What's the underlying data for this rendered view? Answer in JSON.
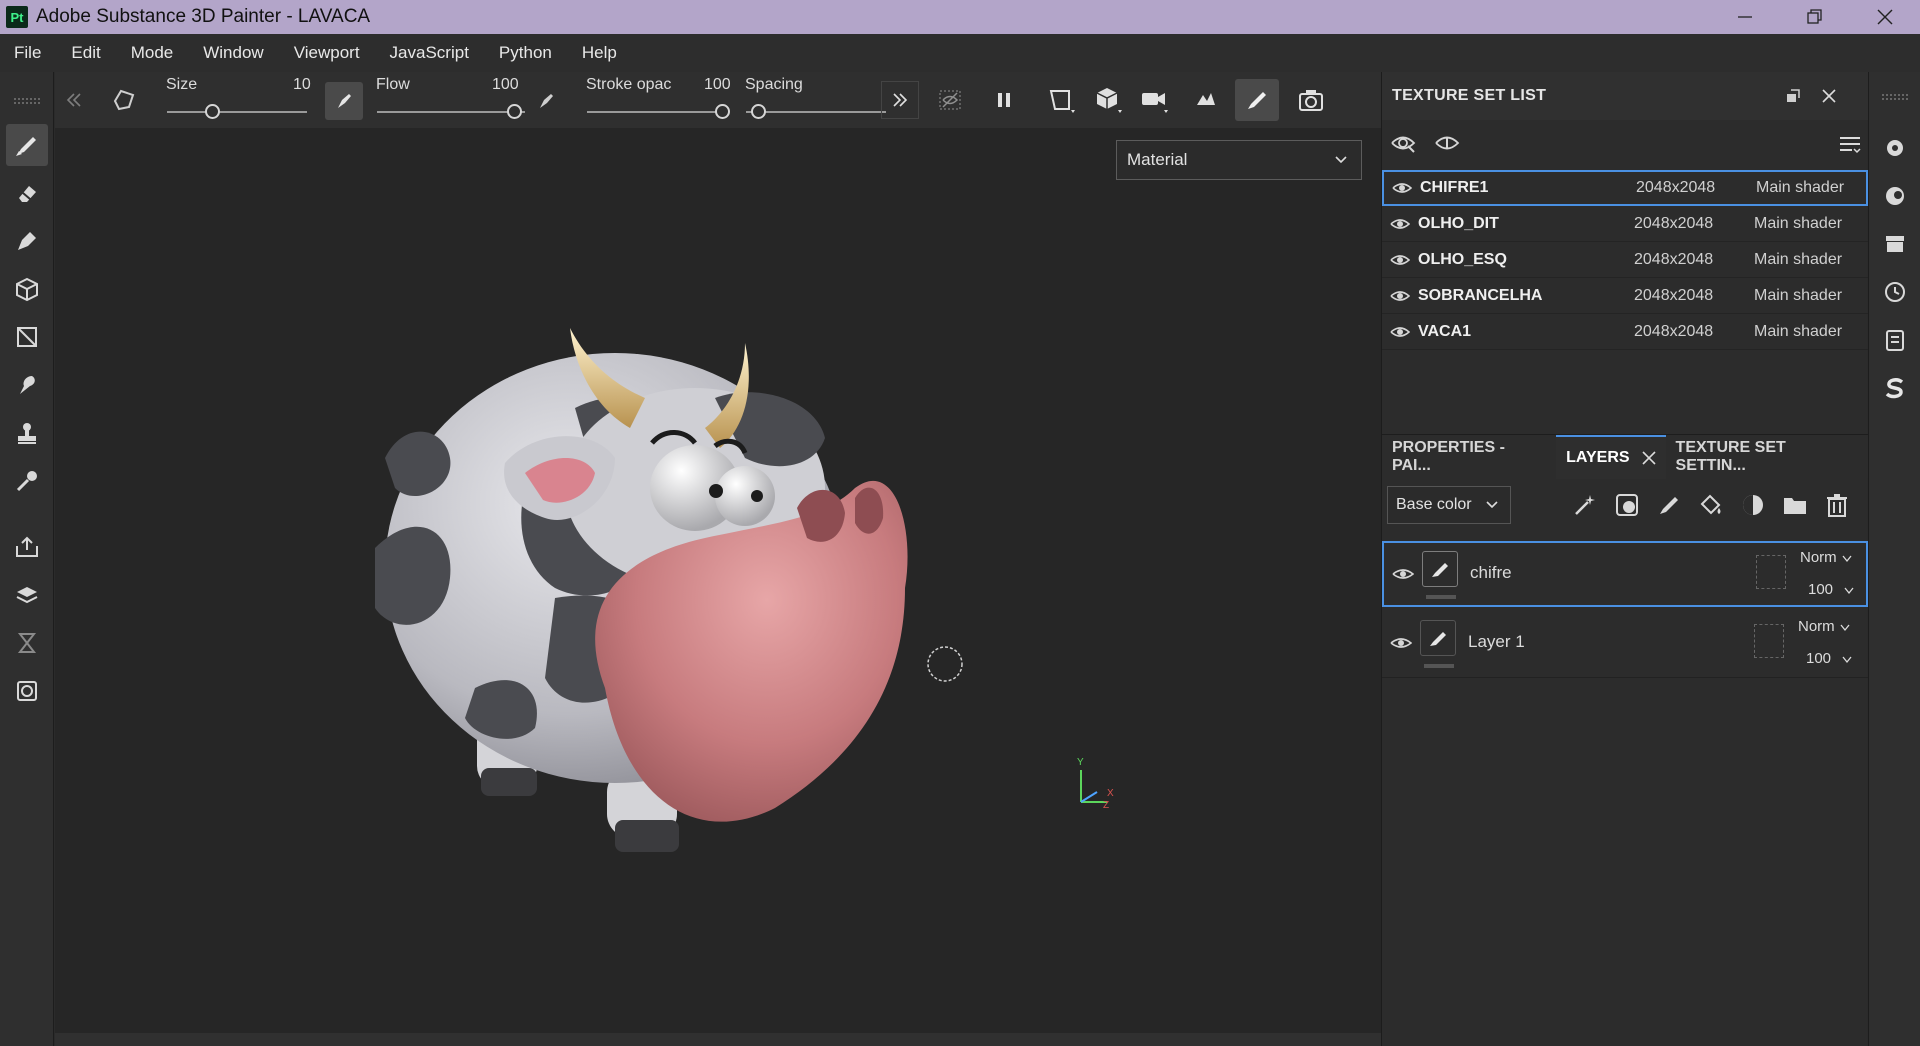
{
  "window": {
    "app_letters": "Pt",
    "title": "Adobe Substance 3D Painter - LAVACA"
  },
  "menu": [
    "File",
    "Edit",
    "Mode",
    "Window",
    "Viewport",
    "JavaScript",
    "Python",
    "Help"
  ],
  "toolbar": {
    "size_label": "Size",
    "size_value": "10",
    "flow_label": "Flow",
    "flow_value": "100",
    "stroke_label": "Stroke opac",
    "stroke_value": "100",
    "spacing_label": "Spacing"
  },
  "viewport": {
    "material_mode": "Material",
    "axis_y": "Y",
    "axis_x": "X",
    "axis_z": "Z"
  },
  "texture_set_list": {
    "title": "TEXTURE SET LIST",
    "rows": [
      {
        "name": "CHIFRE1",
        "size": "2048x2048",
        "shader": "Main shader",
        "selected": true
      },
      {
        "name": "OLHO_DIT",
        "size": "2048x2048",
        "shader": "Main shader",
        "selected": false
      },
      {
        "name": "OLHO_ESQ",
        "size": "2048x2048",
        "shader": "Main shader",
        "selected": false
      },
      {
        "name": "SOBRANCELHA",
        "size": "2048x2048",
        "shader": "Main shader",
        "selected": false
      },
      {
        "name": "VACA1",
        "size": "2048x2048",
        "shader": "Main shader",
        "selected": false
      }
    ]
  },
  "tabs": {
    "properties": "PROPERTIES - PAI...",
    "layers": "LAYERS",
    "texture_set_settings": "TEXTURE SET SETTIN..."
  },
  "layers": {
    "channel": "Base color",
    "items": [
      {
        "name": "chifre",
        "blend": "Norm",
        "opacity": "100",
        "selected": true
      },
      {
        "name": "Layer 1",
        "blend": "Norm",
        "opacity": "100",
        "selected": false
      }
    ]
  },
  "colors": {
    "accent": "#4a90e2",
    "titlebar": "#b3a5c9",
    "viewport_bg": "#262626"
  }
}
